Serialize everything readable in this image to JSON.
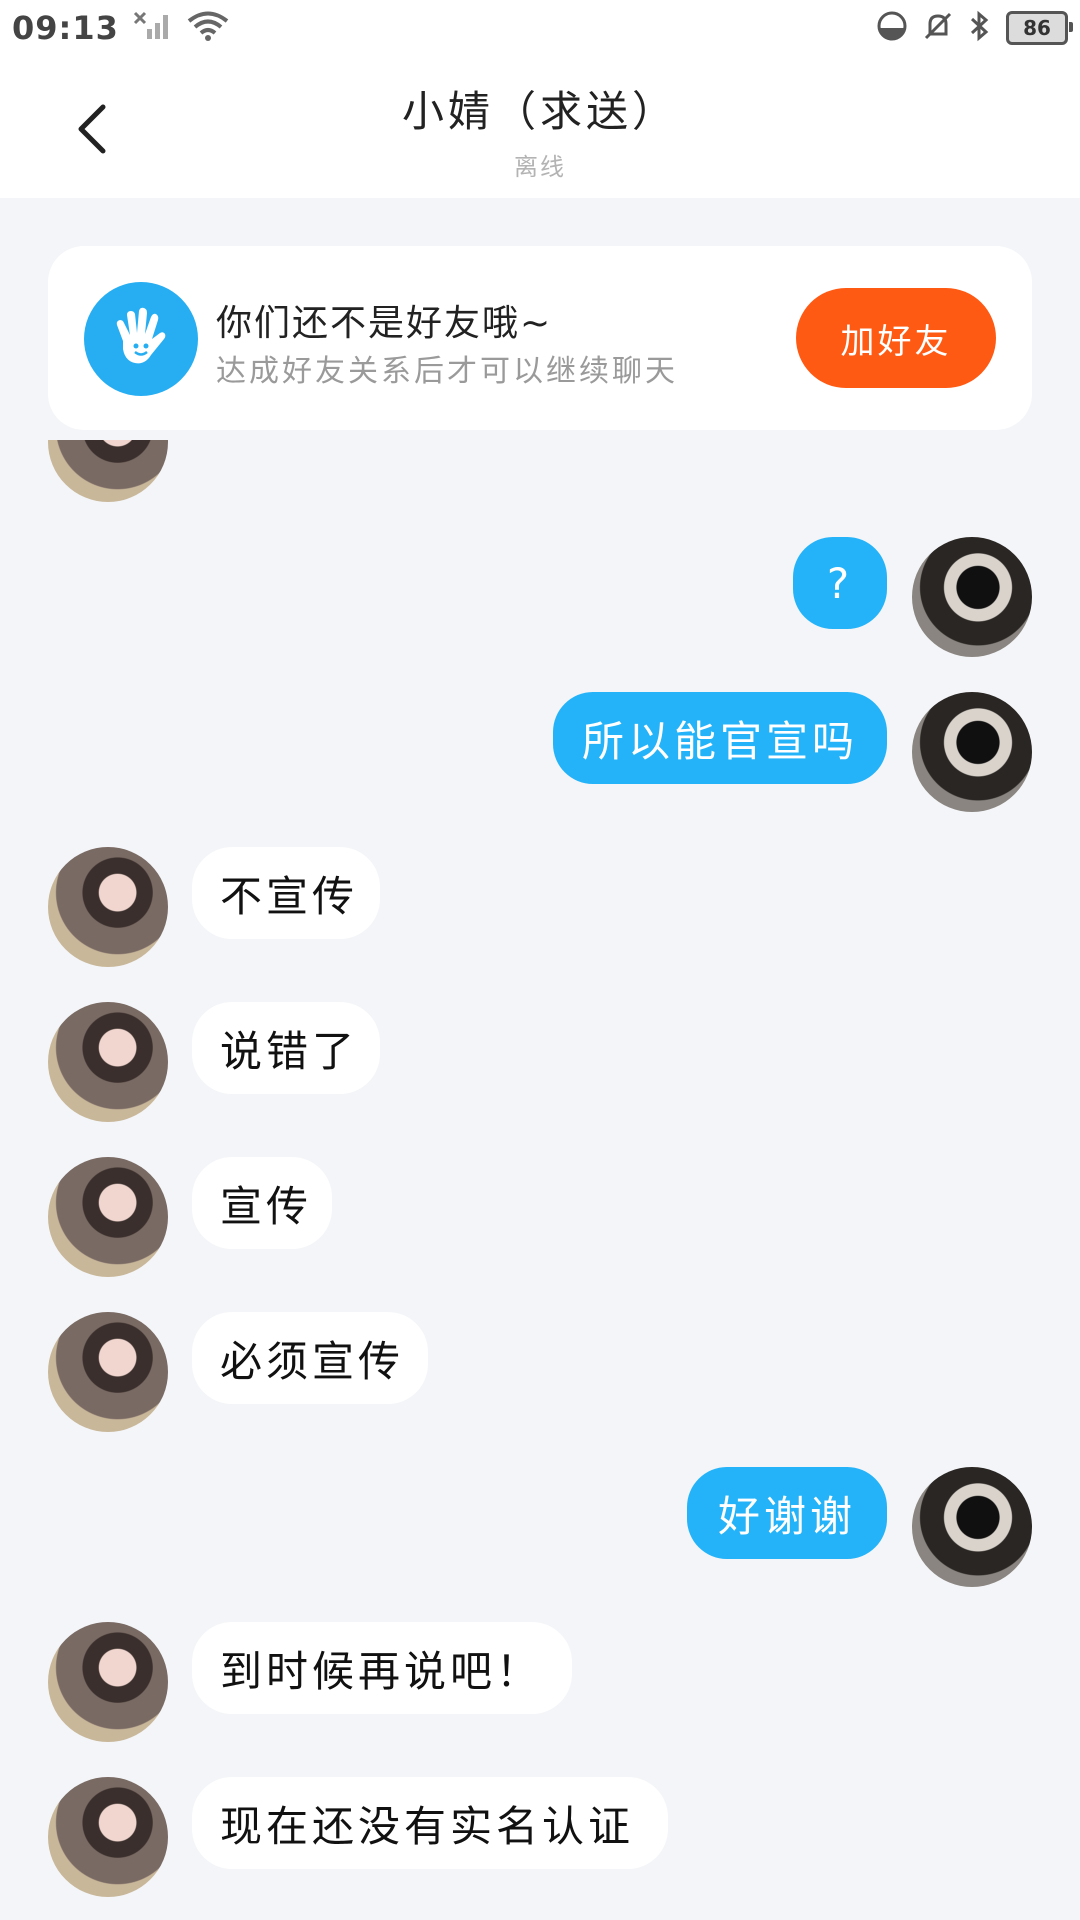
{
  "status_bar": {
    "time": "09:13",
    "battery": "86",
    "icons": [
      "signal-off-icon",
      "wifi-icon",
      "data-saver-icon",
      "mute-icon",
      "bluetooth-icon",
      "battery-icon"
    ]
  },
  "header": {
    "title": "小婧（求送）",
    "subtitle": "离线",
    "back_icon": "chevron-left-icon"
  },
  "banner": {
    "title": "你们还不是好友哦~",
    "subtitle": "达成好友关系后才可以继续聊天",
    "button_label": "加好友",
    "icon": "hand-icon",
    "accent": "#ff5a13",
    "badge_color": "#27aef2"
  },
  "messages": [
    {
      "from": "me",
      "text": "?"
    },
    {
      "from": "me",
      "text": "所以能官宣吗"
    },
    {
      "from": "her",
      "text": "不宣传"
    },
    {
      "from": "her",
      "text": "说错了"
    },
    {
      "from": "her",
      "text": "宣传"
    },
    {
      "from": "her",
      "text": "必须宣传"
    },
    {
      "from": "me",
      "text": "好谢谢"
    },
    {
      "from": "her",
      "text": "到时候再说吧！"
    },
    {
      "from": "her",
      "text": "现在还没有实名认证"
    }
  ],
  "colors": {
    "outgoing_bubble": "#24b3f8",
    "incoming_bubble": "#ffffff",
    "background": "#f3f5f8"
  }
}
